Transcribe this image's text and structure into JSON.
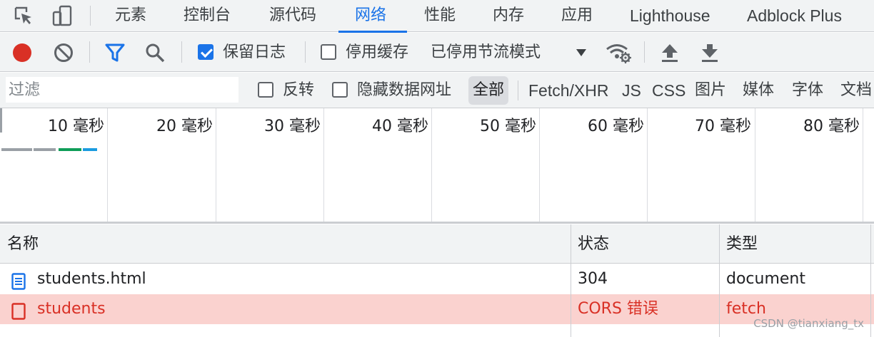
{
  "tabs": {
    "items": [
      {
        "label": "元素"
      },
      {
        "label": "控制台"
      },
      {
        "label": "源代码"
      },
      {
        "label": "网络",
        "active": true
      },
      {
        "label": "性能"
      },
      {
        "label": "内存"
      },
      {
        "label": "应用"
      },
      {
        "label": "Lighthouse"
      },
      {
        "label": "Adblock Plus"
      }
    ]
  },
  "toolbar": {
    "preserve_log_label": "保留日志",
    "preserve_log_checked": true,
    "disable_cache_label": "停用缓存",
    "disable_cache_checked": false,
    "throttling_value": "已停用节流模式"
  },
  "filter": {
    "placeholder": "过滤",
    "invert_label": "反转",
    "hide_data_urls_label": "隐藏数据网址",
    "types": [
      "全部",
      "Fetch/XHR",
      "JS",
      "CSS",
      "图片",
      "媒体",
      "字体",
      "文档"
    ],
    "active_type": "全部"
  },
  "timeline": {
    "ticks": [
      "10 毫秒",
      "20 毫秒",
      "30 毫秒",
      "40 毫秒",
      "50 毫秒",
      "60 毫秒",
      "70 毫秒",
      "80 毫秒"
    ]
  },
  "table": {
    "headers": {
      "name": "名称",
      "status": "状态",
      "type": "类型"
    },
    "rows": [
      {
        "name": "students.html",
        "status": "304",
        "type": "document",
        "icon": "document-icon",
        "error": false
      },
      {
        "name": "students",
        "status": "CORS 错误",
        "type": "fetch",
        "icon": "fetch-icon",
        "error": true
      }
    ]
  },
  "watermark": "CSDN @tianxiang_tx",
  "colors": {
    "accent": "#1a73e8",
    "record": "#d93025",
    "error_row_bg": "#fad2cf",
    "error_text": "#d93025"
  }
}
